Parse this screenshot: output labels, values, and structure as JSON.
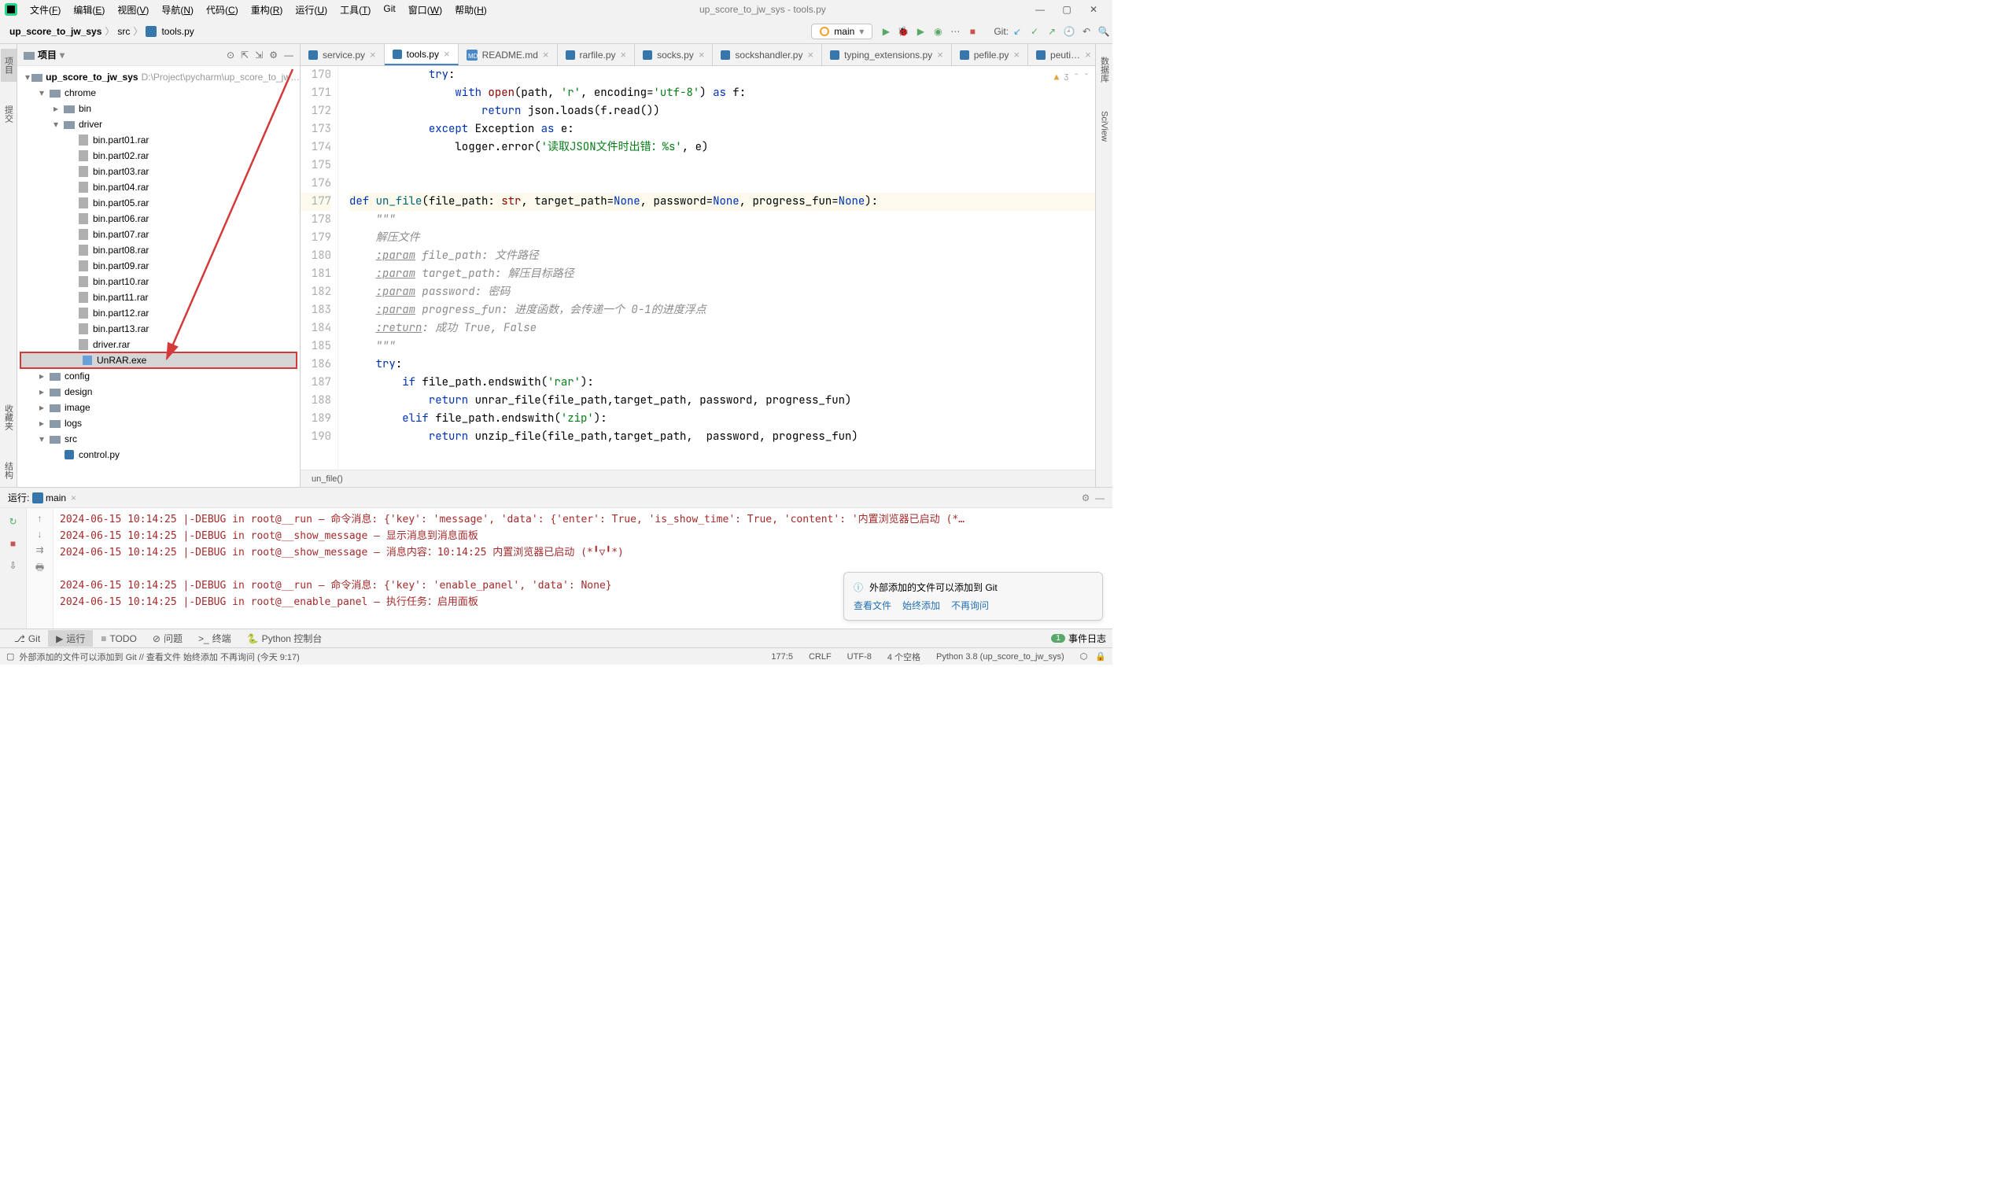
{
  "window_title": "up_score_to_jw_sys - tools.py",
  "menu": [
    "文件(F)",
    "编辑(E)",
    "视图(V)",
    "导航(N)",
    "代码(C)",
    "重构(R)",
    "运行(U)",
    "工具(T)",
    "Git",
    "窗口(W)",
    "帮助(H)"
  ],
  "breadcrumb": [
    "up_score_to_jw_sys",
    "src",
    "tools.py"
  ],
  "git_branch": "main",
  "git_label": "Git:",
  "project_panel_title": "项目",
  "project_root": {
    "name": "up_score_to_jw_sys",
    "path": "D:\\Project\\pycharm\\up_score_to_jw…"
  },
  "tree": {
    "folders_l1": [
      "chrome"
    ],
    "chrome_children": [
      "bin",
      "driver"
    ],
    "driver_files": [
      "bin.part01.rar",
      "bin.part02.rar",
      "bin.part03.rar",
      "bin.part04.rar",
      "bin.part05.rar",
      "bin.part06.rar",
      "bin.part07.rar",
      "bin.part08.rar",
      "bin.part09.rar",
      "bin.part10.rar",
      "bin.part11.rar",
      "bin.part12.rar",
      "bin.part13.rar",
      "driver.rar",
      "UnRAR.exe"
    ],
    "selected": "UnRAR.exe",
    "after_chrome": [
      "config",
      "design",
      "image",
      "logs"
    ],
    "src_open": "src",
    "src_files": [
      "control.py"
    ]
  },
  "left_gutter_tabs": [
    "项目",
    "提交",
    "收藏夹"
  ],
  "right_gutter_tabs": [
    "数据库",
    "SciView"
  ],
  "editor_tabs": [
    {
      "label": "service.py",
      "icon": "py"
    },
    {
      "label": "tools.py",
      "icon": "py",
      "active": true
    },
    {
      "label": "README.md",
      "icon": "md"
    },
    {
      "label": "rarfile.py",
      "icon": "py"
    },
    {
      "label": "socks.py",
      "icon": "py"
    },
    {
      "label": "sockshandler.py",
      "icon": "py"
    },
    {
      "label": "typing_extensions.py",
      "icon": "py"
    },
    {
      "label": "pefile.py",
      "icon": "py"
    },
    {
      "label": "peuti…",
      "icon": "py"
    }
  ],
  "editor_warning_count": "3",
  "code_lines": [
    {
      "n": 170,
      "html": "            <span class='kw'>try</span>:"
    },
    {
      "n": 171,
      "html": "                <span class='kw'>with</span> <span class='builtin'>open</span>(path, <span class='str'>'r'</span>, <span class='ident'>encoding</span>=<span class='str'>'utf-8'</span>) <span class='kw'>as</span> f:"
    },
    {
      "n": 172,
      "html": "                    <span class='kw'>return</span> json.loads(f.read())"
    },
    {
      "n": 173,
      "html": "            <span class='kw'>except</span> <span class='ident'>Exception</span> <span class='kw'>as</span> e:"
    },
    {
      "n": 174,
      "html": "                logger.error(<span class='str'>'读取JSON文件时出错：%s'</span>, e)"
    },
    {
      "n": 175,
      "html": ""
    },
    {
      "n": 176,
      "html": ""
    },
    {
      "n": 177,
      "hl": true,
      "html": "<span class='kw'>def</span> <span class='fn'>un_file</span>(file_path: <span class='builtin'>str</span>, target_path=<span class='kw'>None</span>, password=<span class='kw'>None</span>, progress_fun=<span class='kw'>None</span>):"
    },
    {
      "n": 178,
      "html": "    <span class='comment'>\"\"\"</span>"
    },
    {
      "n": 179,
      "html": "    <span class='comment'>解压文件</span>"
    },
    {
      "n": 180,
      "html": "    <span class='param-tag'>:param</span><span class='comment'> file_path: 文件路径</span>"
    },
    {
      "n": 181,
      "html": "    <span class='param-tag'>:param</span><span class='comment'> target_path: 解压目标路径</span>"
    },
    {
      "n": 182,
      "html": "    <span class='param-tag'>:param</span><span class='comment'> password: 密码</span>"
    },
    {
      "n": 183,
      "html": "    <span class='param-tag'>:param</span><span class='comment'> progress_fun: 进度函数，会传递一个 0-1的进度浮点</span>"
    },
    {
      "n": 184,
      "html": "    <span class='param-tag'>:return</span><span class='comment'>: 成功 True, False</span>"
    },
    {
      "n": 185,
      "html": "    <span class='comment'>\"\"\"</span>"
    },
    {
      "n": 186,
      "html": "    <span class='kw'>try</span>:"
    },
    {
      "n": 187,
      "html": "        <span class='kw'>if</span> file_path.endswith(<span class='str'>'rar'</span>):"
    },
    {
      "n": 188,
      "html": "            <span class='kw'>return</span> unrar_file(file_path,target_path, password, progress_fun)"
    },
    {
      "n": 189,
      "html": "        <span class='kw'>elif</span> file_path.endswith(<span class='str'>'zip'</span>):"
    },
    {
      "n": 190,
      "html": "            <span class='kw'>return</span> unzip_file(file_path,target_path,  password, progress_fun)"
    }
  ],
  "editor_breadcrumb": "un_file()",
  "run_label": "运行:",
  "run_config": "main",
  "console": [
    "2024-06-15 10:14:25 |-DEBUG in root@__run – 命令消息: {'key': 'message', 'data': {'enter': True, 'is_show_time': True, 'content': '内置浏览器已启动 (*…",
    "2024-06-15 10:14:25 |-DEBUG in root@__show_message – 显示消息到消息面板",
    "2024-06-15 10:14:25 |-DEBUG in root@__show_message – 消息内容：10:14:25 内置浏览器已启动 (*╹▽╹*)",
    "",
    "2024-06-15 10:14:25 |-DEBUG in root@__run – 命令消息: {'key': 'enable_panel', 'data': None}",
    "2024-06-15 10:14:25 |-DEBUG in root@__enable_panel – 执行任务：启用面板"
  ],
  "notification": {
    "title": "外部添加的文件可以添加到 Git",
    "links": [
      "查看文件",
      "始终添加",
      "不再询问"
    ]
  },
  "bottom_tabs": [
    "Git",
    "运行",
    "TODO",
    "问题",
    "终端",
    "Python 控制台"
  ],
  "active_bottom_tab": "运行",
  "event_log": {
    "count": "1",
    "label": "事件日志"
  },
  "status": {
    "message": "外部添加的文件可以添加到 Git // 查看文件   始终添加   不再询问 (今天 9:17)",
    "caret": "177:5",
    "line_ending": "CRLF",
    "encoding": "UTF-8",
    "indent": "4 个空格",
    "interpreter": "Python 3.8 (up_score_to_jw_sys)"
  }
}
